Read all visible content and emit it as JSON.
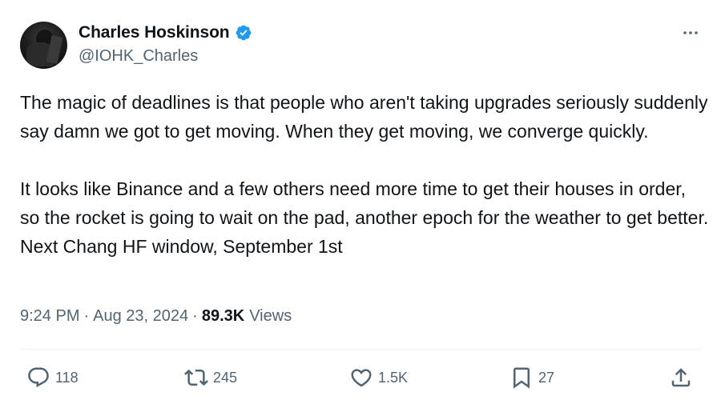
{
  "author": {
    "display_name": "Charles Hoskinson",
    "handle": "@IOHK_Charles",
    "verified": true
  },
  "tweet": {
    "paragraphs": [
      "The magic of deadlines is that people who aren't taking upgrades seriously suddenly say damn we got to get moving. When they get moving, we converge quickly.",
      "It looks like Binance and a few others need more time to get their houses in order, so the rocket is going to wait on the pad, another epoch for the weather to get better. Next Chang HF window, September 1st"
    ],
    "time": "9:24 PM",
    "date": "Aug 23, 2024",
    "views_count": "89.3K",
    "views_label": "Views"
  },
  "stats": {
    "replies": "118",
    "reposts": "245",
    "likes": "1.5K",
    "bookmarks": "27"
  },
  "icons": {
    "more": "more-horizontal-icon",
    "verified": "verified-badge-icon",
    "reply": "reply-icon",
    "repost": "repost-icon",
    "like": "heart-icon",
    "bookmark": "bookmark-icon",
    "share": "share-icon"
  },
  "colors": {
    "verified_blue": "#1d9bf0",
    "text_primary": "#0f1419",
    "text_secondary": "#536471",
    "divider": "#eff3f4"
  }
}
